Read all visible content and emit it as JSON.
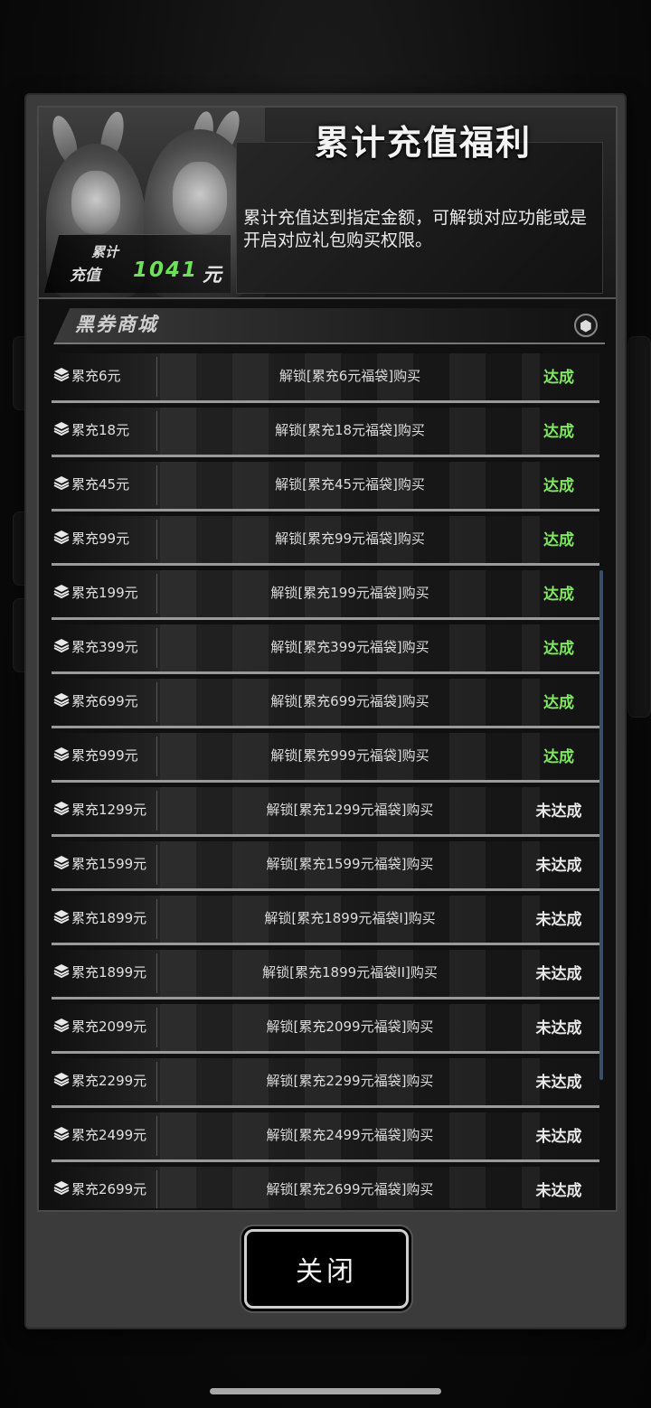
{
  "header": {
    "title": "累计充值福利",
    "description": "累计充值达到指定金额，可解锁对应功能或是开启对应礼包购买权限。",
    "total_label_line1": "累计",
    "total_label_line2": "充值",
    "total_value": "1041",
    "total_unit": "元"
  },
  "section": {
    "title": "黑券商城",
    "icon": "hexagon-icon"
  },
  "rows": [
    {
      "amount": "累充6元",
      "desc": "解锁[累充6元福袋]购买",
      "status": "达成",
      "done": true
    },
    {
      "amount": "累充18元",
      "desc": "解锁[累充18元福袋]购买",
      "status": "达成",
      "done": true
    },
    {
      "amount": "累充45元",
      "desc": "解锁[累充45元福袋]购买",
      "status": "达成",
      "done": true
    },
    {
      "amount": "累充99元",
      "desc": "解锁[累充99元福袋]购买",
      "status": "达成",
      "done": true
    },
    {
      "amount": "累充199元",
      "desc": "解锁[累充199元福袋]购买",
      "status": "达成",
      "done": true
    },
    {
      "amount": "累充399元",
      "desc": "解锁[累充399元福袋]购买",
      "status": "达成",
      "done": true
    },
    {
      "amount": "累充699元",
      "desc": "解锁[累充699元福袋]购买",
      "status": "达成",
      "done": true
    },
    {
      "amount": "累充999元",
      "desc": "解锁[累充999元福袋]购买",
      "status": "达成",
      "done": true
    },
    {
      "amount": "累充1299元",
      "desc": "解锁[累充1299元福袋]购买",
      "status": "未达成",
      "done": false
    },
    {
      "amount": "累充1599元",
      "desc": "解锁[累充1599元福袋]购买",
      "status": "未达成",
      "done": false
    },
    {
      "amount": "累充1899元",
      "desc": "解锁[累充1899元福袋I]购买",
      "status": "未达成",
      "done": false
    },
    {
      "amount": "累充1899元",
      "desc": "解锁[累充1899元福袋II]购买",
      "status": "未达成",
      "done": false
    },
    {
      "amount": "累充2099元",
      "desc": "解锁[累充2099元福袋]购买",
      "status": "未达成",
      "done": false
    },
    {
      "amount": "累充2299元",
      "desc": "解锁[累充2299元福袋]购买",
      "status": "未达成",
      "done": false
    },
    {
      "amount": "累充2499元",
      "desc": "解锁[累充2499元福袋]购买",
      "status": "未达成",
      "done": false
    },
    {
      "amount": "累充2699元",
      "desc": "解锁[累充2699元福袋]购买",
      "status": "未达成",
      "done": false
    }
  ],
  "colors": {
    "done": "#7ee85f",
    "not_done": "#e8e8e8",
    "total_value": "#6fe05a"
  },
  "close_button": {
    "label": "关闭"
  }
}
